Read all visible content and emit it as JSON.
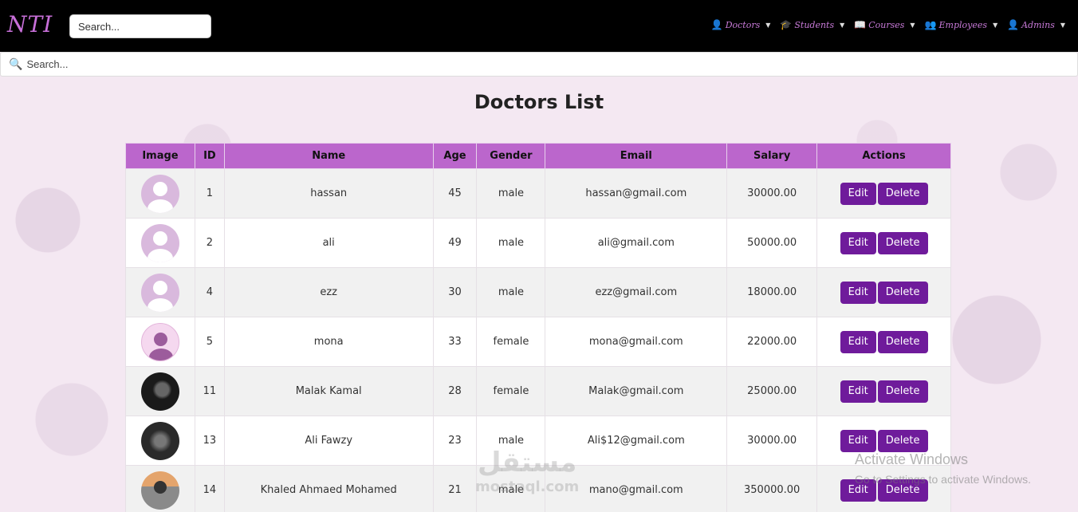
{
  "navbar": {
    "brand": "NTI",
    "search_placeholder": "Search...",
    "menu": [
      {
        "label": "Doctors",
        "icon": "user-doctor-icon"
      },
      {
        "label": "Students",
        "icon": "user-graduate-icon"
      },
      {
        "label": "Courses",
        "icon": "book-icon"
      },
      {
        "label": "Employees",
        "icon": "users-gear-icon"
      },
      {
        "label": "Admins",
        "icon": "user-gear-icon"
      }
    ]
  },
  "search": {
    "placeholder": "Search..."
  },
  "page": {
    "title": "Doctors List"
  },
  "table": {
    "headers": [
      "Image",
      "ID",
      "Name",
      "Age",
      "Gender",
      "Email",
      "Salary",
      "Actions"
    ],
    "rows": [
      {
        "id": "1",
        "name": "hassan",
        "age": "45",
        "gender": "male",
        "email": "hassan@gmail.com",
        "salary": "30000.00",
        "avatar": "default"
      },
      {
        "id": "2",
        "name": "ali",
        "age": "49",
        "gender": "male",
        "email": "ali@gmail.com",
        "salary": "50000.00",
        "avatar": "default"
      },
      {
        "id": "4",
        "name": "ezz",
        "age": "30",
        "gender": "male",
        "email": "ezz@gmail.com",
        "salary": "18000.00",
        "avatar": "default"
      },
      {
        "id": "5",
        "name": "mona",
        "age": "33",
        "gender": "female",
        "email": "mona@gmail.com",
        "salary": "22000.00",
        "avatar": "pink"
      },
      {
        "id": "11",
        "name": "Malak Kamal",
        "age": "28",
        "gender": "female",
        "email": "Malak@gmail.com",
        "salary": "25000.00",
        "avatar": "dark"
      },
      {
        "id": "13",
        "name": "Ali Fawzy",
        "age": "23",
        "gender": "male",
        "email": "Ali$12@gmail.com",
        "salary": "30000.00",
        "avatar": "dark2"
      },
      {
        "id": "14",
        "name": "Khaled Ahmaed Mohamed",
        "age": "21",
        "gender": "male",
        "email": "mano@gmail.com",
        "salary": "350000.00",
        "avatar": "photo"
      }
    ],
    "edit_label": "Edit",
    "delete_label": "Delete"
  },
  "overlay": {
    "activate_title": "Activate Windows",
    "activate_sub": "Go to Settings to activate Windows.",
    "mostaql_ar": "مستقل",
    "mostaql_en": "mostaql.com"
  },
  "colors": {
    "accent": "#bb66cc",
    "button": "#6f1b9b",
    "navbar": "#000000",
    "nav_text": "#c87ad8"
  }
}
